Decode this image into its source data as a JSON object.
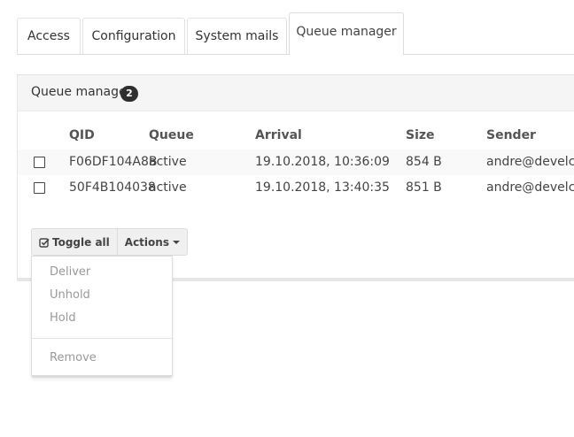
{
  "tabs": [
    {
      "label": "Access"
    },
    {
      "label": "Configuration"
    },
    {
      "label": "System mails"
    },
    {
      "label": "Queue manager",
      "active": true
    }
  ],
  "panel": {
    "title": "Queue manager",
    "badge_count": "2"
  },
  "table": {
    "columns": [
      "QID",
      "Queue",
      "Arrival",
      "Size",
      "Sender"
    ],
    "rows": [
      {
        "qid": "F06DF104A8B",
        "queue": "active",
        "arrival": "19.10.2018, 10:36:09",
        "size": "854 B",
        "sender": "andre@develcow"
      },
      {
        "qid": "50F4B104038",
        "queue": "active",
        "arrival": "19.10.2018, 13:40:35",
        "size": "851 B",
        "sender": "andre@develcow"
      }
    ]
  },
  "buttons": {
    "toggle_all_label": "Toggle all",
    "actions_label": "Actions"
  },
  "dropdown": {
    "items": [
      "Deliver",
      "Unhold",
      "Hold"
    ],
    "after_divider": [
      "Remove"
    ]
  },
  "icons": {
    "toggle": "check-square-icon",
    "actions": "caret-down-icon"
  },
  "colors": {
    "badge_bg": "#2f2f2f",
    "panel_header_bg": "#f5f5f5",
    "menu_text_disabled": "#999999"
  }
}
